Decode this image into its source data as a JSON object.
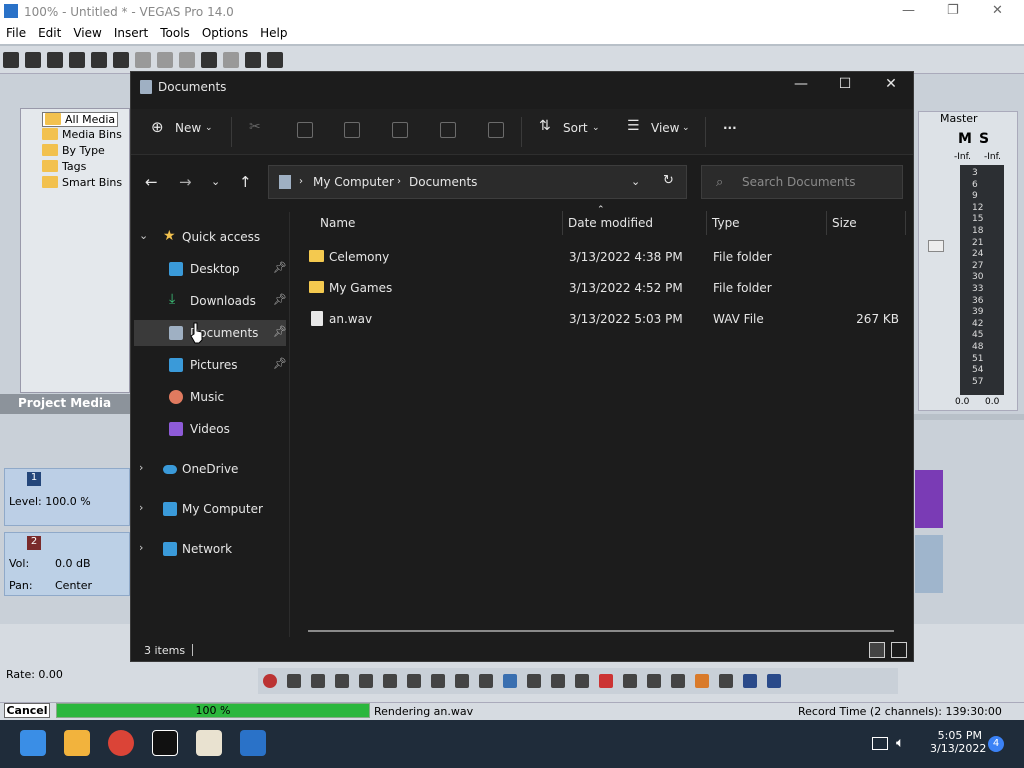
{
  "vegas": {
    "title": "100% - Untitled * - VEGAS Pro 14.0",
    "menu": [
      "File",
      "Edit",
      "View",
      "Insert",
      "Tools",
      "Options",
      "Help"
    ],
    "media_tree": [
      "All Media",
      "Media Bins",
      "By Type",
      "Tags",
      "Smart Bins"
    ],
    "project_media_tab": "Project Media",
    "track1": {
      "num": "1",
      "level": "Level: 100.0 %"
    },
    "track2": {
      "num": "2",
      "vol_label": "Vol:",
      "vol_value": "0.0 dB",
      "pan_label": "Pan:",
      "pan_value": "Center"
    },
    "master_label": "Master",
    "master_buttons": [
      "M",
      "S"
    ],
    "meter_top": [
      "-Inf.",
      "-Inf."
    ],
    "meter_ticks": [
      "3",
      "6",
      "9",
      "12",
      "15",
      "18",
      "21",
      "24",
      "27",
      "30",
      "33",
      "36",
      "39",
      "42",
      "45",
      "48",
      "51",
      "54",
      "57"
    ],
    "meter_bottom": [
      "0.0",
      "0.0"
    ],
    "rate": "Rate: 0.00",
    "cancel": "Cancel",
    "progress": {
      "text": "100 %",
      "fraction": 1.0
    },
    "render_status": "Rendering an.wav",
    "record_time": "Record Time (2 channels): 139:30:00"
  },
  "explorer": {
    "title": "Documents",
    "cmd": {
      "new": "New",
      "sort": "Sort",
      "view": "View",
      "more": "..."
    },
    "address": {
      "root": "My Computer",
      "current": "Documents"
    },
    "search_placeholder": "Search Documents",
    "nav": {
      "quick_access": "Quick access",
      "desktop": "Desktop",
      "downloads": "Downloads",
      "documents": "Documents",
      "pictures": "Pictures",
      "music": "Music",
      "videos": "Videos",
      "onedrive": "OneDrive",
      "my_computer": "My Computer",
      "network": "Network"
    },
    "columns": {
      "name": "Name",
      "date": "Date modified",
      "type": "Type",
      "size": "Size"
    },
    "files": [
      {
        "name": "Celemony",
        "date": "3/13/2022 4:38 PM",
        "type": "File folder",
        "size": ""
      },
      {
        "name": "My Games",
        "date": "3/13/2022 4:52 PM",
        "type": "File folder",
        "size": ""
      },
      {
        "name": "an.wav",
        "date": "3/13/2022 5:03 PM",
        "type": "WAV File",
        "size": "267 KB"
      }
    ],
    "status": "3 items"
  },
  "taskbar": {
    "time": "5:05 PM",
    "date": "3/13/2022",
    "notifications": "4"
  }
}
